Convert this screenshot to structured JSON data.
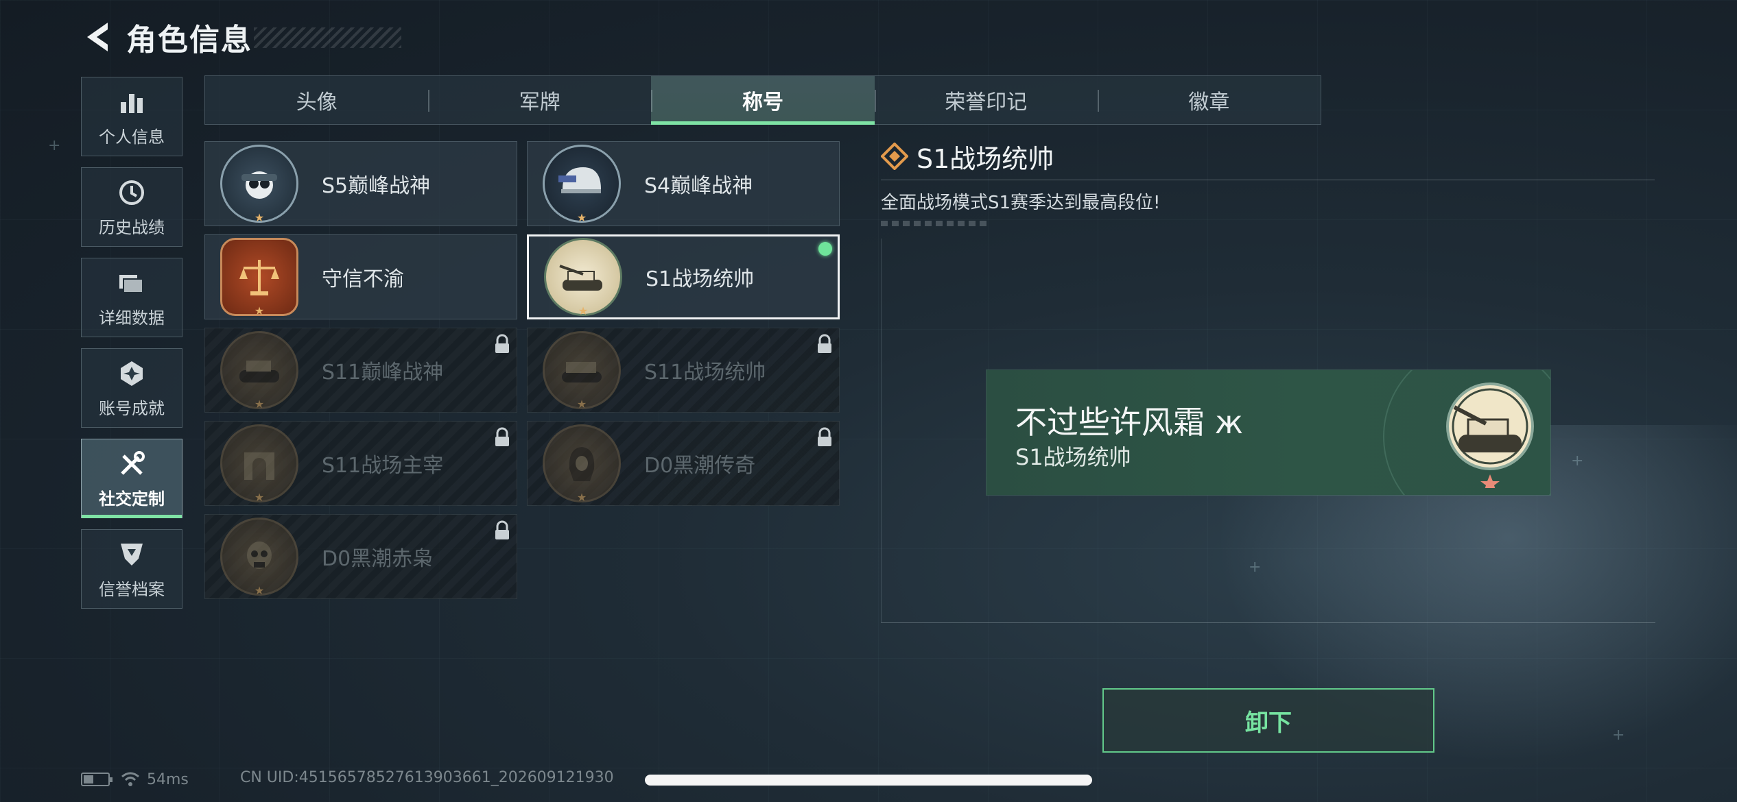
{
  "header": {
    "title": "角色信息"
  },
  "side_nav": [
    {
      "label": "个人信息",
      "icon": "bar-chart-icon"
    },
    {
      "label": "历史战绩",
      "icon": "clock-icon"
    },
    {
      "label": "详细数据",
      "icon": "folder-icon"
    },
    {
      "label": "账号成就",
      "icon": "achievement-icon"
    },
    {
      "label": "社交定制",
      "icon": "tools-icon",
      "active": true
    },
    {
      "label": "信誉档案",
      "icon": "shield-icon"
    }
  ],
  "tabs": [
    {
      "label": "头像"
    },
    {
      "label": "军牌"
    },
    {
      "label": "称号",
      "active": true
    },
    {
      "label": "荣誉印记"
    },
    {
      "label": "徽章"
    }
  ],
  "titles": [
    {
      "name": "S5巅峰战神",
      "locked": false,
      "emblem": "skull-goggles-emblem"
    },
    {
      "name": "S4巅峰战神",
      "locked": false,
      "emblem": "helmet-emblem"
    },
    {
      "name": "守信不渝",
      "locked": false,
      "emblem": "scales-emblem"
    },
    {
      "name": "S1战场统帅",
      "locked": false,
      "selected": true,
      "equipped": true,
      "emblem": "tank-emblem"
    },
    {
      "name": "S11巅峰战神",
      "locked": true,
      "emblem": "armored-vehicle-emblem"
    },
    {
      "name": "S11战场统帅",
      "locked": true,
      "emblem": "apc-emblem"
    },
    {
      "name": "S11战场主宰",
      "locked": true,
      "emblem": "arch-emblem"
    },
    {
      "name": "D0黑潮传奇",
      "locked": true,
      "emblem": "hooded-figure-emblem"
    },
    {
      "name": "D0黑潮赤枭",
      "locked": true,
      "emblem": "masked-skull-emblem"
    }
  ],
  "detail": {
    "title": "S1战场统帅",
    "description": "全面战场模式S1赛季达到最高段位!"
  },
  "preview": {
    "player_name": "不过些许风霜 ж",
    "title": "S1战场统帅"
  },
  "actions": {
    "unequip_label": "卸下"
  },
  "status": {
    "ping": "54ms",
    "uid": "CN UID:4515657852761390366​1_202609121930"
  },
  "colors": {
    "accent": "#7fe3a5",
    "button_text": "#76e3a0",
    "banner": "#2e5546"
  }
}
